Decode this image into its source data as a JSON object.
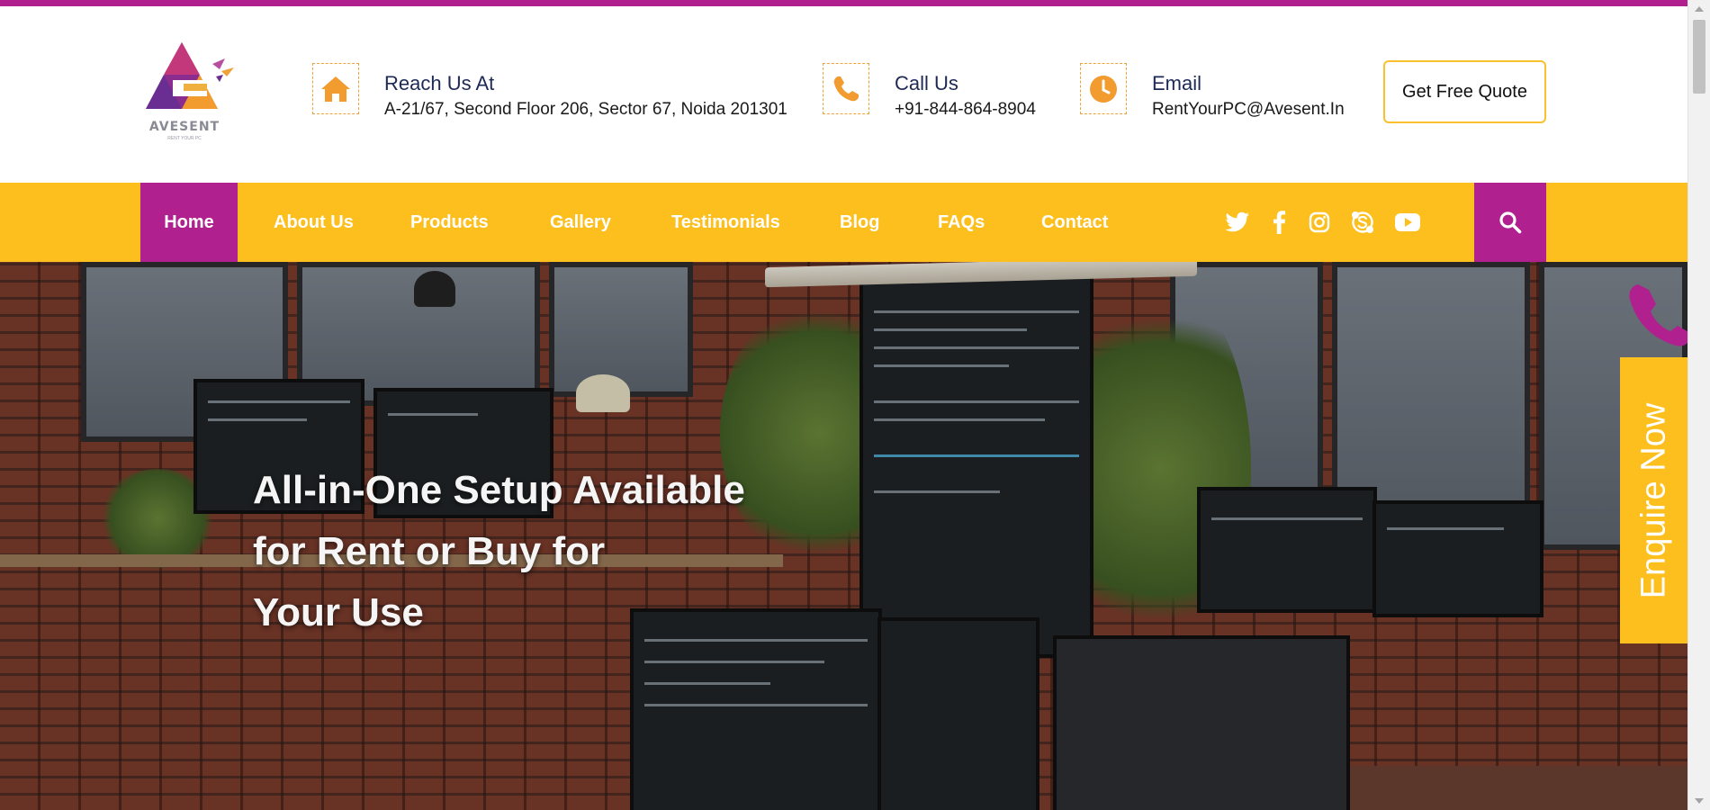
{
  "brand": {
    "name": "AVESENT",
    "tagline": "RENT YOUR PC",
    "primary_color": "#b0218f",
    "accent_color": "#fcbf1e"
  },
  "contact": {
    "address": {
      "icon": "home-icon",
      "title": "Reach Us At",
      "value": "A-21/67, Second Floor 206, Sector 67, Noida 201301"
    },
    "phone": {
      "icon": "phone-icon",
      "title": "Call Us",
      "value": "+91-844-864-8904"
    },
    "email": {
      "icon": "clock-icon",
      "title": "Email",
      "value": "RentYourPC@Avesent.In"
    }
  },
  "header": {
    "quote_button": "Get Free Quote"
  },
  "nav": {
    "items": [
      {
        "label": "Home",
        "active": true
      },
      {
        "label": "About Us"
      },
      {
        "label": "Products"
      },
      {
        "label": "Gallery"
      },
      {
        "label": "Testimonials"
      },
      {
        "label": "Blog"
      },
      {
        "label": "FAQs"
      },
      {
        "label": "Contact"
      }
    ],
    "social": [
      "twitter-icon",
      "facebook-icon",
      "instagram-icon",
      "skype-icon",
      "youtube-icon"
    ],
    "search_icon": "search-icon"
  },
  "hero": {
    "title_lines": [
      "All-in-One Setup Available",
      "for Rent or Buy for",
      "Your Use"
    ]
  },
  "enquire": {
    "label": "Enquire Now",
    "icon": "phone-icon"
  }
}
